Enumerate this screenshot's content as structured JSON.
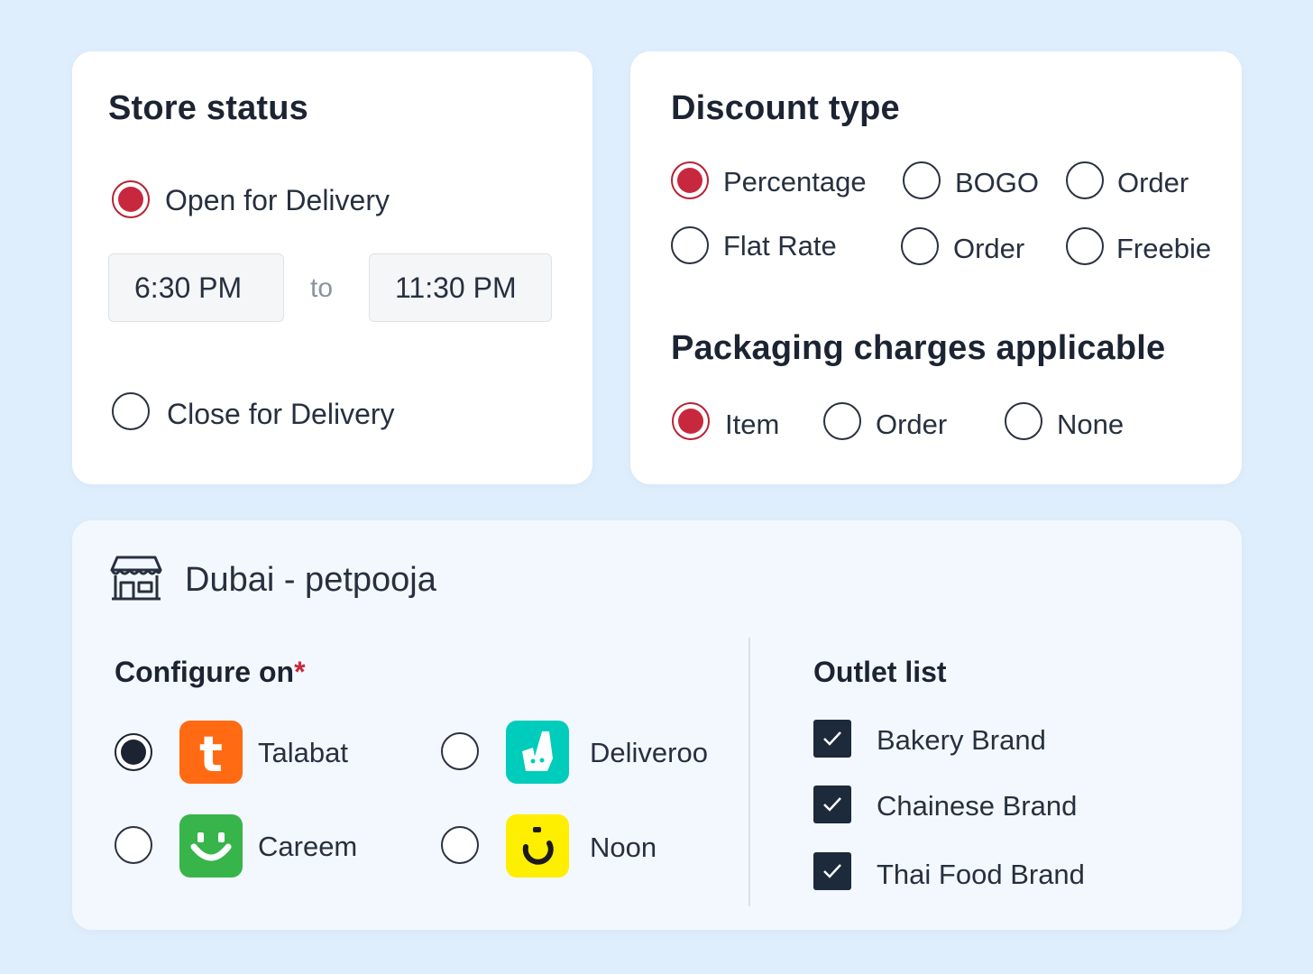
{
  "store_status": {
    "title": "Store status",
    "open_label": "Open for Delivery",
    "from_time": "6:30 PM",
    "to_label": "to",
    "to_time": "11:30 PM",
    "close_label": "Close for Delivery",
    "selected": "open"
  },
  "discount_type": {
    "title": "Discount type",
    "options": [
      "Percentage",
      "BOGO",
      "Order",
      "Flat Rate",
      "Order",
      "Freebie"
    ],
    "selected": "Percentage"
  },
  "packaging": {
    "title": "Packaging charges applicable",
    "options": [
      "Item",
      "Order",
      "None"
    ],
    "selected": "Item"
  },
  "outlet": {
    "store_icon": "store-icon",
    "name": "Dubai - petpooja",
    "configure_title": "Configure on",
    "required_mark": "*",
    "platforms": [
      {
        "name": "Talabat",
        "icon": "talabat-logo",
        "color": "#ff6a13",
        "selected": true
      },
      {
        "name": "Deliveroo",
        "icon": "deliveroo-logo",
        "color": "#00ccbc",
        "selected": false
      },
      {
        "name": "Careem",
        "icon": "careem-logo",
        "color": "#37b44a",
        "selected": false
      },
      {
        "name": "Noon",
        "icon": "noon-logo",
        "color": "#feee00",
        "selected": false
      }
    ],
    "outlet_list_title": "Outlet list",
    "outlets": [
      {
        "name": "Bakery Brand",
        "checked": true
      },
      {
        "name": "Chainese Brand",
        "checked": true
      },
      {
        "name": "Thai Food Brand",
        "checked": true
      }
    ]
  },
  "colors": {
    "background": "#dfeefc",
    "accent_red": "#c8283d",
    "dark": "#1c2433"
  }
}
